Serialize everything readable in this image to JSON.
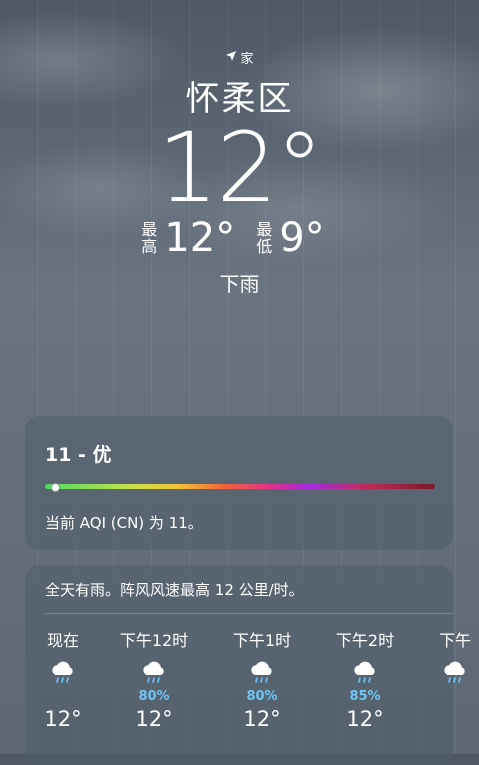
{
  "location": {
    "tag": "家",
    "city": "怀柔区"
  },
  "current": {
    "temp": "12°",
    "high_label": "最高",
    "high": "12°",
    "low_label": "最低",
    "low": "9°",
    "condition": "下雨"
  },
  "aqi": {
    "title": "11 - 优",
    "value": 11,
    "description": "当前 AQI (CN) 为 11。"
  },
  "forecast": {
    "summary": "全天有雨。阵风风速最高 12 公里/时。",
    "hours": [
      {
        "time": "现在",
        "icon": "rain-cloud-icon",
        "precip": "",
        "temp": "12°"
      },
      {
        "time": "下午12时",
        "icon": "rain-cloud-icon",
        "precip": "80%",
        "temp": "12°"
      },
      {
        "time": "下午1时",
        "icon": "rain-cloud-icon",
        "precip": "80%",
        "temp": "12°"
      },
      {
        "time": "下午2时",
        "icon": "rain-cloud-icon",
        "precip": "85%",
        "temp": "12°"
      },
      {
        "time": "下午",
        "icon": "rain-cloud-icon",
        "precip": "",
        "temp": ""
      }
    ]
  }
}
